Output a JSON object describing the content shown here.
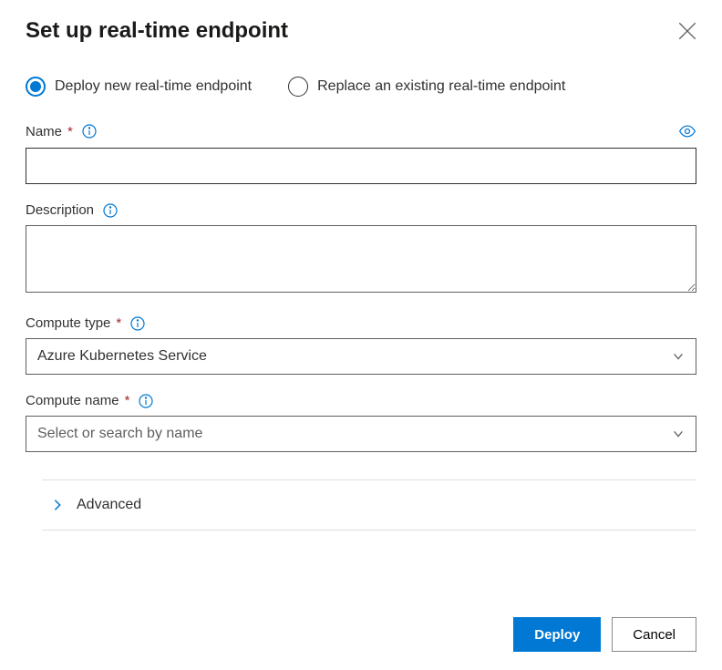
{
  "dialog": {
    "title": "Set up real-time endpoint"
  },
  "radio": {
    "deploy_new": "Deploy new real-time endpoint",
    "replace_existing": "Replace an existing real-time endpoint"
  },
  "fields": {
    "name": {
      "label": "Name",
      "value": ""
    },
    "description": {
      "label": "Description",
      "value": ""
    },
    "compute_type": {
      "label": "Compute type",
      "value": "Azure Kubernetes Service"
    },
    "compute_name": {
      "label": "Compute name",
      "placeholder": "Select or search by name"
    }
  },
  "advanced": {
    "label": "Advanced"
  },
  "buttons": {
    "deploy": "Deploy",
    "cancel": "Cancel"
  }
}
